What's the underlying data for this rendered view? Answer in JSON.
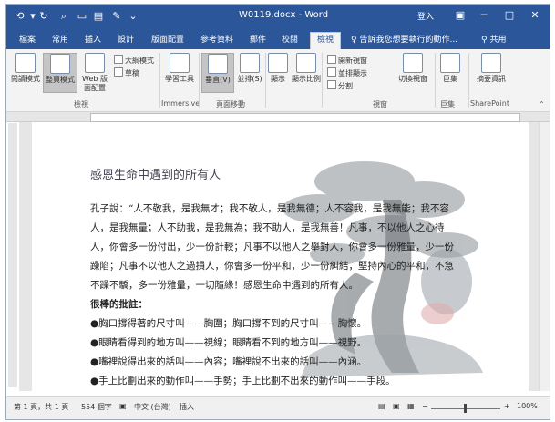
{
  "titlebar": {
    "doc_title": "W0119.docx - Word",
    "login": "登入",
    "icons": [
      "save-icon",
      "undo-icon",
      "redo-icon",
      "print-preview-icon",
      "new-icon",
      "open-icon",
      "format-icon",
      "customize-icon"
    ]
  },
  "tabs": [
    "檔案",
    "常用",
    "插入",
    "設計",
    "版面配置",
    "參考資料",
    "郵件",
    "校閱",
    "檢視"
  ],
  "active_tab": "檢視",
  "tellme": "告訴我您想要執行的動作...",
  "share": "共用",
  "ribbon": {
    "read_mode": "閱讀模式",
    "print_layout": "整頁模式",
    "web_layout": "Web 版面配置",
    "outline": "大綱模式",
    "draft": "草稿",
    "group_views": "檢視",
    "learning_tools": "學習工具",
    "group_immersive": "Immersive",
    "vertical": "垂直(V)",
    "side_by_side": "並排(S)",
    "group_page_move": "頁面移動",
    "show": "顯示",
    "zoom": "顯示比例",
    "new_window": "開新視窗",
    "arrange_all": "並排顯示",
    "split": "分割",
    "switch_windows": "切換視窗",
    "group_window": "視窗",
    "macros": "巨集",
    "group_macros": "巨集",
    "summary": "摘要資訊",
    "group_sharepoint": "SharePoint"
  },
  "document": {
    "heading": "感恩生命中遇到的所有人",
    "lines": [
      "孔子說：“人不敬我，是我無才；我不敬人，是我無德；人不容我，是我無能；我不容",
      "人，是我無量；人不助我，是我無為；我不助人，是我無善！凡事，不以他人之心待",
      "人，你會多一份付出，少一份計較；凡事不以他人之舉對人，你會多一份雅量，少一份",
      "躁陷；凡事不以他人之過損人，你會多一份平和，少一份糾結，堅持內心的平和，不急",
      "不躁不驕，多一份雅量，一切隨緣！感恩生命中遇到的所有人。",
      "很棒的批註：",
      "●胸口撐得著的尺寸叫——胸圍；胸口撐不到的尺寸叫——胸懷。",
      "●眼睛看得到的地方叫——視線；眼睛看不到的地方叫——視野。",
      "●嘴裡說得出來的話叫——內容；嘴裡說不出來的話叫——內涵。",
      "●手上比劃出來的動作叫——手勢；手上比劃不出來的動作叫——手段。"
    ]
  },
  "status": {
    "page": "第 1 頁，共 1 頁",
    "words": "554 個字",
    "lang": "中文 (台灣)",
    "mode": "插入",
    "zoom": "100%",
    "minus": "−",
    "plus": "+"
  }
}
